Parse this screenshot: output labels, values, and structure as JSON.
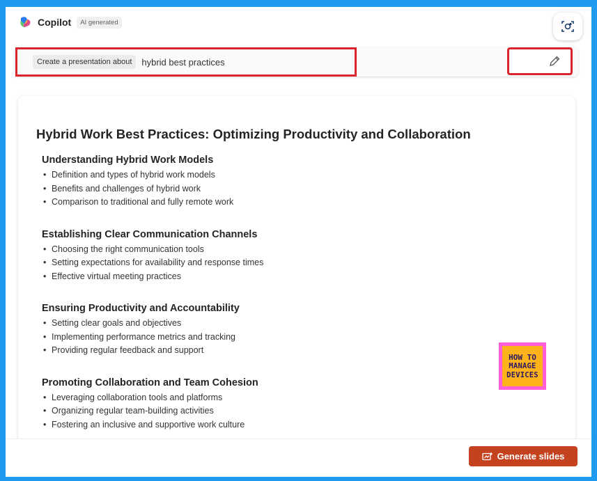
{
  "header": {
    "app_title": "Copilot",
    "badge": "AI generated"
  },
  "prompt": {
    "chip": "Create a presentation about",
    "text": "hybrid best practices"
  },
  "document": {
    "title": "Hybrid Work Best Practices: Optimizing Productivity and Collaboration",
    "sections": [
      {
        "title": "Understanding Hybrid Work Models",
        "items": [
          "Definition and types of hybrid work models",
          "Benefits and challenges of hybrid work",
          "Comparison to traditional and fully remote work"
        ]
      },
      {
        "title": "Establishing Clear Communication Channels",
        "items": [
          "Choosing the right communication tools",
          "Setting expectations for availability and response times",
          "Effective virtual meeting practices"
        ]
      },
      {
        "title": "Ensuring Productivity and Accountability",
        "items": [
          "Setting clear goals and objectives",
          "Implementing performance metrics and tracking",
          "Providing regular feedback and support"
        ]
      },
      {
        "title": "Promoting Collaboration and Team Cohesion",
        "items": [
          "Leveraging collaboration tools and platforms",
          "Organizing regular team-building activities",
          "Fostering an inclusive and supportive work culture"
        ]
      }
    ]
  },
  "watermark": {
    "line1": "HOW TO",
    "line2": "MANAGE",
    "line3": "DEVICES"
  },
  "footer": {
    "generate_label": "Generate slides"
  },
  "icons": {
    "logo": "copilot-logo",
    "scan": "scan-icon",
    "edit": "pencil-icon",
    "generate": "slides-icon"
  },
  "colors": {
    "accent": "#c4421e",
    "highlight": "#d9262e",
    "frame": "#1e9bf0"
  }
}
